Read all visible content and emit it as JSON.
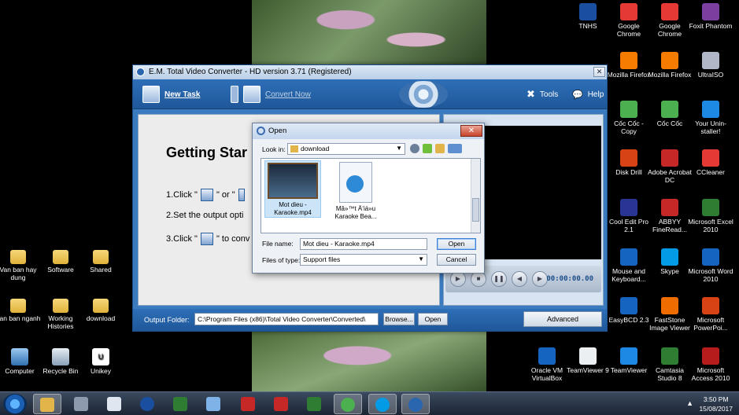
{
  "desktop": {
    "left_icons": [
      {
        "label": "Van ban hay dung",
        "kind": "folder"
      },
      {
        "label": "Software",
        "kind": "folder"
      },
      {
        "label": "Shared",
        "kind": "folder"
      },
      {
        "label": "Van ban nganh",
        "kind": "folder"
      },
      {
        "label": "Working Histories",
        "kind": "folder"
      },
      {
        "label": "download",
        "kind": "folder"
      },
      {
        "label": "Computer",
        "kind": "computer"
      },
      {
        "label": "Recycle Bin",
        "kind": "recycle"
      },
      {
        "label": "Unikey",
        "kind": "unikey"
      }
    ],
    "right_icons": [
      {
        "label": "TNHS",
        "color": "#1a4fa0"
      },
      {
        "label": "Google Chrome",
        "color": "#e53935"
      },
      {
        "label": "Google Chrome",
        "color": "#e53935"
      },
      {
        "label": "Foxit Phantom",
        "color": "#7b3fa0"
      },
      {
        "label": "Mozilla Firefox",
        "color": "#f57c00"
      },
      {
        "label": "Mozilla Firefox",
        "color": "#f57c00"
      },
      {
        "label": "UltraISO",
        "color": "#b0b8c8"
      },
      {
        "label": "Cốc Cốc - Copy",
        "color": "#4caf50"
      },
      {
        "label": "Cốc Cốc",
        "color": "#4caf50"
      },
      {
        "label": "Your Unin-staller!",
        "color": "#1e88e5"
      },
      {
        "label": "Disk Drill",
        "color": "#d84315"
      },
      {
        "label": "Adobe Acrobat DC",
        "color": "#c62828"
      },
      {
        "label": "CCleaner",
        "color": "#e53935"
      },
      {
        "label": "Cool Edit Pro 2.1",
        "color": "#283593"
      },
      {
        "label": "ABBYY FineRead...",
        "color": "#c62828"
      },
      {
        "label": "Microsoft Excel 2010",
        "color": "#2e7d32"
      },
      {
        "label": "Mouse and Keyboard...",
        "color": "#1565c0"
      },
      {
        "label": "Skype",
        "color": "#039be5"
      },
      {
        "label": "Microsoft Word 2010",
        "color": "#1565c0"
      },
      {
        "label": "EasyBCD 2.3",
        "color": "#1565c0"
      },
      {
        "label": "FastStone Image Viewer",
        "color": "#ef6c00"
      },
      {
        "label": "Microsoft PowerPoi...",
        "color": "#d84315"
      },
      {
        "label": "Oracle VM VirtualBox",
        "color": "#1565c0"
      },
      {
        "label": "TeamViewer 9",
        "color": "#eceff1"
      },
      {
        "label": "TeamViewer",
        "color": "#1e88e5"
      },
      {
        "label": "Camtasia Studio 8",
        "color": "#2e7d32"
      },
      {
        "label": "Microsoft Access 2010",
        "color": "#b71c1c"
      }
    ]
  },
  "main_window": {
    "title": "E.M. Total Video Converter - HD version 3.71 (Registered)",
    "toolbar": {
      "new_task": "New Task",
      "convert_now": "Convert Now",
      "tools": "Tools",
      "help": "Help"
    },
    "getting_started": {
      "title": "Getting Star",
      "step1_prefix": "1.Click \"",
      "step1_mid": "\" or \"",
      "step2": "2.Set the output opti",
      "step3_prefix": "3.Click \"",
      "step3_suffix": "\" to conv"
    },
    "player": {
      "time": "00:00:00.00"
    },
    "output": {
      "label": "Output Folder:",
      "path": "C:\\Program Files (x86)\\Total Video Converter\\Converted\\",
      "browse": "Browse...",
      "open": "Open",
      "advanced": "Advanced"
    }
  },
  "open_dialog": {
    "title": "Open",
    "look_in_label": "Look in:",
    "look_in_value": "download",
    "files": [
      {
        "name": "Mot dieu - Karaoke.mp4",
        "selected": true
      },
      {
        "name": "Mâ»™t Ä‘iá»u Karaoke Bea...",
        "selected": false
      }
    ],
    "file_name_label": "File name:",
    "file_name_value": "Mot dieu - Karaoke.mp4",
    "files_of_type_label": "Files of type:",
    "files_of_type_value": "Support files",
    "open_button": "Open",
    "cancel_button": "Cancel"
  },
  "taskbar": {
    "time": "3:50 PM",
    "date": "15/08/2017",
    "tray_label": "▲"
  }
}
